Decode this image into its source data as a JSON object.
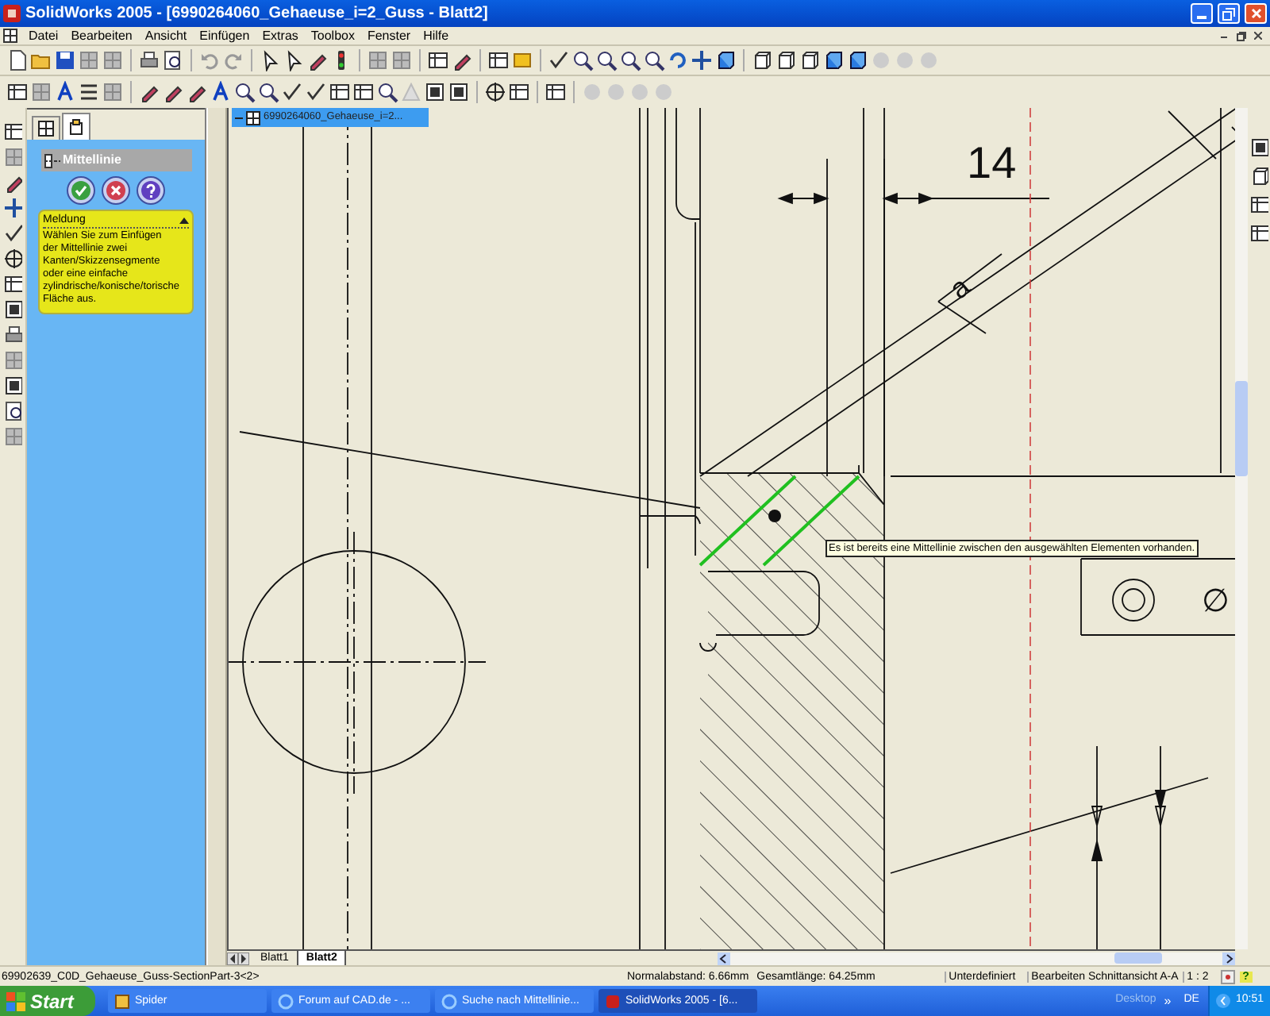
{
  "window": {
    "title": "SolidWorks 2005 - [6990264060_Gehaeuse_i=2_Guss - Blatt2]"
  },
  "menu": [
    "Datei",
    "Bearbeiten",
    "Ansicht",
    "Einfügen",
    "Extras",
    "Toolbox",
    "Fenster",
    "Hilfe"
  ],
  "panel_tabs": [
    {
      "selected": false
    },
    {
      "selected": true
    }
  ],
  "property_manager": {
    "title": "Mittellinie",
    "message": {
      "heading": "Meldung",
      "expanded": true,
      "text": "Wählen Sie zum Einfügen der Mittellinie zwei Kanten/Skizzensegmente oder eine einfache zylindrische/konische/torische Fläche aus."
    }
  },
  "document_tab": {
    "title": "6990264060_Gehaeuse_i=2..."
  },
  "drawing": {
    "dimension": "14",
    "weld_symbol": "a",
    "diameter_symbol": "∅",
    "tooltip": "Es ist bereits eine Mittellinie zwischen den ausgewählten Elementen vorhanden."
  },
  "sheet_tabs": [
    {
      "label": "Blatt1",
      "selected": false
    },
    {
      "label": "Blatt2",
      "selected": true
    }
  ],
  "status_bar": {
    "selection": "69902639_C0D_Gehaeuse_Guss-SectionPart-3<2>",
    "distance": "Normalabstand: 6.66mm",
    "length": "Gesamtlänge: 64.25mm",
    "state": "Unterdefiniert",
    "mode": "Bearbeiten Schnittansicht A-A",
    "scale": "1 : 2",
    "help": "?"
  },
  "taskbar": {
    "start": "Start",
    "tasks": [
      {
        "label": "Spider",
        "selected": false
      },
      {
        "label": "Forum auf CAD.de - ...",
        "selected": false
      },
      {
        "label": "Suche nach Mittellinie...",
        "selected": false
      },
      {
        "label": "SolidWorks 2005 - [6...",
        "selected": true
      }
    ],
    "desktop": "Desktop",
    "chevron": "»",
    "language": "DE",
    "clock": "10:51"
  }
}
